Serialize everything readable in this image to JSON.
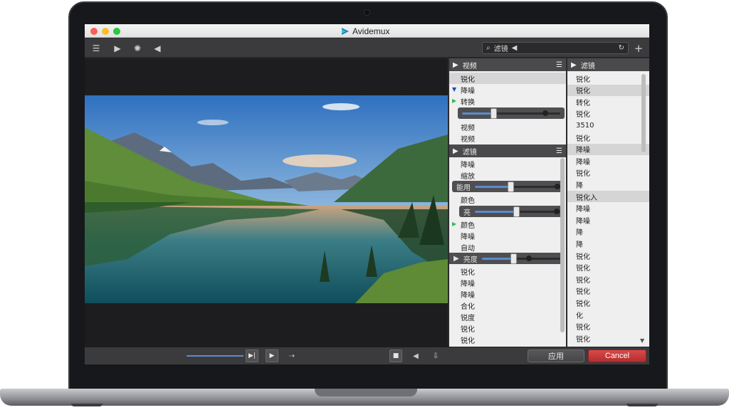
{
  "window": {
    "title": "Avidemux"
  },
  "toolbar": {
    "buttons": [
      {
        "icon": "menu-icon",
        "glyph": "☰"
      },
      {
        "icon": "play-icon",
        "glyph": "▶"
      },
      {
        "icon": "effects-icon",
        "glyph": "✺"
      },
      {
        "icon": "audio-icon",
        "glyph": "◀"
      }
    ],
    "search": {
      "label": "滤镜",
      "icon": "search-icon"
    }
  },
  "left_panel": {
    "header": "视频",
    "section1": [
      "锐化",
      "降噪",
      "转换"
    ],
    "section1_after": [
      "视频",
      "视频"
    ],
    "header2": "滤镜",
    "section2": [
      "降噪",
      "缩放"
    ],
    "slider_a_label": "能用",
    "section3": [
      "颜色"
    ],
    "slider_b_label": "亮",
    "section4": [
      "颜色",
      "降噪",
      "自动"
    ],
    "slider_c_label": "亮度",
    "section5": [
      "锐化",
      "降噪",
      "降噪",
      "合化",
      "锐度",
      "锐化",
      "锐化"
    ],
    "slider_values": {
      "s1": 0.32,
      "s2": 0.42,
      "s3": 0.48,
      "s4": 0.4
    }
  },
  "right_panel": {
    "header": "滤镜",
    "items": [
      "锐化",
      "锐化",
      "转化",
      "锐化",
      "3510",
      "锐化",
      "降噪",
      "降噪",
      "锐化",
      "降",
      "锐化入",
      "降噪",
      "降噪",
      "降",
      "降",
      "锐化",
      "锐化",
      "锐化",
      "锐化",
      "锐化",
      "化",
      "锐化",
      "锐化"
    ]
  },
  "buttons": {
    "apply": "应用",
    "cancel": "Cancel"
  },
  "colors": {
    "accent": "#5b8bd0",
    "cancel": "#c23434",
    "traffic_close": "#ff5f57",
    "traffic_min": "#febc2e",
    "traffic_max": "#28c840"
  }
}
